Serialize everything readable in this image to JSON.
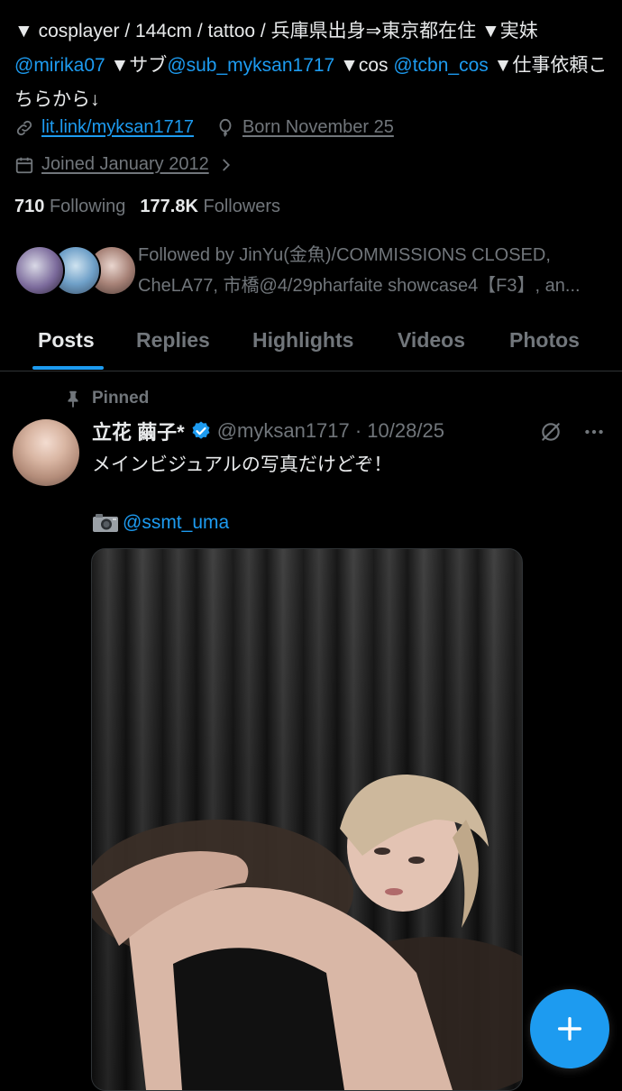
{
  "profile": {
    "bio_parts": [
      {
        "text": "▼ cosplayer / 144cm / tattoo / 兵庫県出身⇒東京都在住 ▼実妹",
        "mention": false
      },
      {
        "text": "@mirika07",
        "mention": true
      },
      {
        "text": " ▼サブ",
        "mention": false
      },
      {
        "text": "@sub_myksan1717",
        "mention": true
      },
      {
        "text": " ▼cos ",
        "mention": false
      },
      {
        "text": "@tcbn_cos",
        "mention": true
      },
      {
        "text": " ▼仕事依頼こちらから↓",
        "mention": false
      }
    ],
    "link": "lit.link/myksan1717",
    "born": "Born November 25",
    "joined": "Joined January 2012",
    "following_count": "710",
    "following_label": "Following",
    "followers_count": "177.8K",
    "followers_label": "Followers",
    "followed_by": "Followed by JinYu(金魚)/COMMISSIONS CLOSED, CheLA77, 市橋@4/29pharfaite showcase4【F3】, an..."
  },
  "tabs": [
    {
      "label": "Posts",
      "active": true
    },
    {
      "label": "Replies",
      "active": false
    },
    {
      "label": "Highlights",
      "active": false
    },
    {
      "label": "Videos",
      "active": false
    },
    {
      "label": "Photos",
      "active": false
    }
  ],
  "pinned_post": {
    "pinned_label": "Pinned",
    "display_name": "立花 繭子*",
    "handle_date": "@myksan1717 · 10/28/25",
    "text": "メインビジュアルの写真だけどぞ！",
    "credit_mention": "@ssmt_uma"
  },
  "icons": {
    "link": "link-icon",
    "born": "balloon-icon",
    "joined": "calendar-icon",
    "pin": "pin-icon",
    "verified": "verified-badge-icon",
    "grok": "grok-icon",
    "more": "more-icon",
    "camera": "camera-icon",
    "compose": "plus-icon"
  },
  "colors": {
    "accent": "#1d9bf0",
    "text": "#e7e9ea",
    "muted": "#71767b",
    "background": "#000000"
  }
}
